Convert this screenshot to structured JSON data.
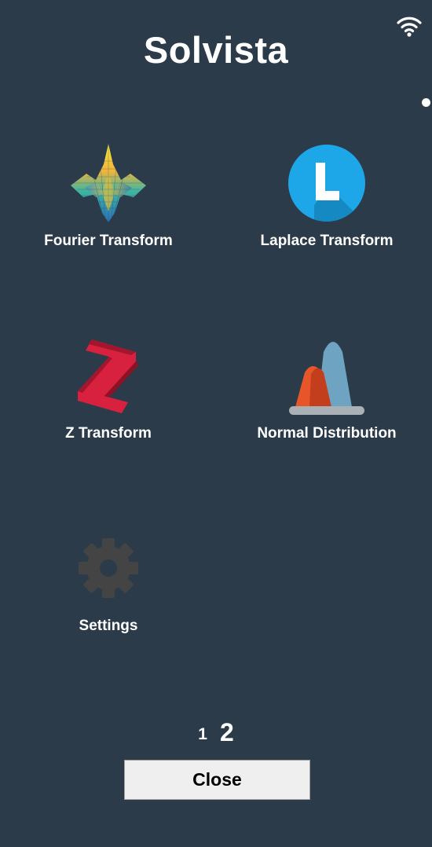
{
  "app": {
    "title": "Solvista"
  },
  "status": {
    "wifi_icon": "wifi-icon"
  },
  "tiles": [
    {
      "label": "Fourier Transform",
      "icon": "fourier-surface-icon"
    },
    {
      "label": "Laplace Transform",
      "icon": "laplace-l-icon"
    },
    {
      "label": "Z Transform",
      "icon": "z-letter-icon"
    },
    {
      "label": "Normal Distribution",
      "icon": "normal-distribution-icon"
    },
    {
      "label": "Settings",
      "icon": "gear-icon"
    }
  ],
  "pager": {
    "pages": [
      "1",
      "2"
    ],
    "current": "2"
  },
  "footer": {
    "close_label": "Close"
  },
  "colors": {
    "background": "#2b3b4a",
    "text": "#ffffff",
    "laplace_blue": "#1ea7e8",
    "z_red": "#d8203f",
    "gear_gray": "#444444",
    "button_bg": "#efefef"
  }
}
